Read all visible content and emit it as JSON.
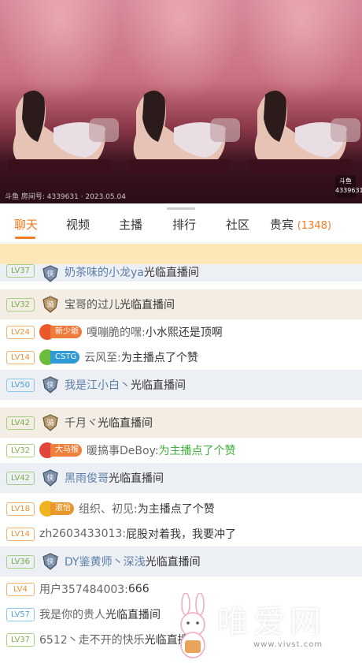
{
  "video": {
    "meta": "斗鱼 房间号: 4339631 · 2023.05.04",
    "logo": "斗鱼",
    "logo_sub": "4339631"
  },
  "tabs": [
    {
      "label": "聊天",
      "active": true
    },
    {
      "label": "视频",
      "active": false
    },
    {
      "label": "主播",
      "active": false
    },
    {
      "label": "排行",
      "active": false
    },
    {
      "label": "社区",
      "active": false
    },
    {
      "label": "贵宾",
      "active": false
    }
  ],
  "guest_count": "(1348)",
  "chat": {
    "r0": {
      "level": "LV37",
      "name": "奶茶味的小龙ya",
      "text": "光临直播间"
    },
    "r1": {
      "level": "LV32",
      "name": "宝哥的过儿",
      "text": "光临直播间"
    },
    "r2": {
      "level": "LV24",
      "fan": "新少爺",
      "name": "嘎嘣脆的嘿:",
      "text": " 小水熙还是顶啊"
    },
    "r3": {
      "level": "LV14",
      "fan": "CSTG",
      "name": "云风至:",
      "text": " 为主播点了个赞"
    },
    "r4": {
      "level": "LV50",
      "name": "我是江小白丶",
      "text": "光临直播间"
    },
    "r5": {
      "level": "LV42",
      "name": "千月ヾ",
      "text": "光临直播间"
    },
    "r6": {
      "level": "LV32",
      "fan": "大马猴",
      "name": "暖搞事DeBoy:",
      "text": " 为主播点了个赞"
    },
    "r7": {
      "level": "LV42",
      "name": "黑雨俊哥",
      "text": "光临直播间"
    },
    "r8": {
      "level": "LV18",
      "fan": "淑怡",
      "name": "组织、初见:",
      "text": " 为主播点了个赞"
    },
    "r9": {
      "level": "LV14",
      "name": "zh2603433013:",
      "text": " 屁股对着我，我要冲了"
    },
    "r10": {
      "level": "LV36",
      "name": "DY鉴黄师丶深浅",
      "text": "光临直播间"
    },
    "r11": {
      "level": "LV4",
      "name": "用户357484003:",
      "text": " 666"
    },
    "r12": {
      "level": "LV57",
      "name": "我是你的贵人",
      "text": "光临直播间"
    },
    "r13": {
      "level": "LV37",
      "name": "6512丶走不开的快乐",
      "text": "光临直播间"
    }
  },
  "watermark": {
    "text": "唯爱网",
    "url": "www.vivst.com"
  },
  "colors": {
    "accent": "#f27a1f",
    "name_blue": "#5b7fa9",
    "like_green": "#3fae3a"
  }
}
